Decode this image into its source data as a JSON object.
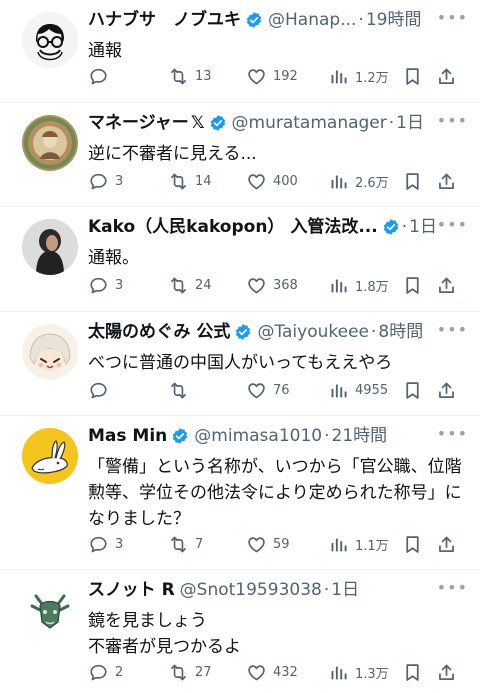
{
  "tweets": [
    {
      "name": "ハナブサ　ノブユキ",
      "verified": true,
      "handle": "@Hanap...",
      "time": "19時間",
      "text": "通報",
      "replies": "",
      "retweets": "13",
      "likes": "192",
      "views": "1.2万"
    },
    {
      "name": "マネージャー",
      "xmark": "𝕏",
      "verified": true,
      "handle": "@muratamanager",
      "time": "1日",
      "text": "逆に不審者に見える...",
      "replies": "3",
      "retweets": "14",
      "likes": "400",
      "views": "2.6万"
    },
    {
      "name": "Kako（人民kakopon） 入管法改...",
      "verified": true,
      "handle": "",
      "time": "1日",
      "text": "通報。",
      "replies": "3",
      "retweets": "24",
      "likes": "368",
      "views": "1.8万"
    },
    {
      "name": "太陽のめぐみ 公式",
      "verified": true,
      "handle": "@Taiyoukeee",
      "time": "8時間",
      "text": "べつに普通の中国人がいってもええやろ",
      "replies": "",
      "retweets": "",
      "likes": "76",
      "views": "4955"
    },
    {
      "name": "Mas Min",
      "verified": true,
      "handle": "@mimasa1010",
      "time": "21時間",
      "text": "「警備」という名称が、いつから「官公職、位階勲等、学位その他法令により定められた称号」になりました？",
      "replies": "3",
      "retweets": "7",
      "likes": "59",
      "views": "1.1万"
    },
    {
      "name": "スノット R",
      "verified": false,
      "handle": "@Snot19593038",
      "time": "1日",
      "text": "鏡を見ましょう\n不審者が見つかるよ",
      "replies": "2",
      "retweets": "27",
      "likes": "432",
      "views": "1.3万"
    }
  ],
  "colors": {
    "text": "#0f1419",
    "muted": "#536471",
    "verified": "#1d9bf0",
    "divider": "#eff3f4"
  },
  "icons": [
    "reply-icon",
    "retweet-icon",
    "like-icon",
    "views-icon",
    "bookmark-icon",
    "share-icon",
    "verified-badge-icon",
    "more-icon"
  ]
}
